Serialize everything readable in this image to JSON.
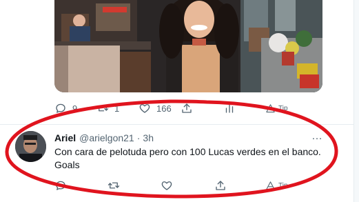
{
  "top_tweet": {
    "media_alt": "Photo",
    "actions": {
      "reply_count": "9",
      "retweet_count": "1",
      "like_count": "166",
      "tip_label": "Tip"
    }
  },
  "reply_tweet": {
    "display_name": "Ariel",
    "handle": "@arielgon21",
    "separator": "·",
    "time": "3h",
    "text": "Con cara de pelotuda pero con 100 Lucas verdes en el banco. Goals",
    "more_icon": "…",
    "actions": {
      "tip_label": "Tip"
    }
  },
  "annotation": {
    "shape": "ellipse",
    "color": "#e0141e"
  }
}
